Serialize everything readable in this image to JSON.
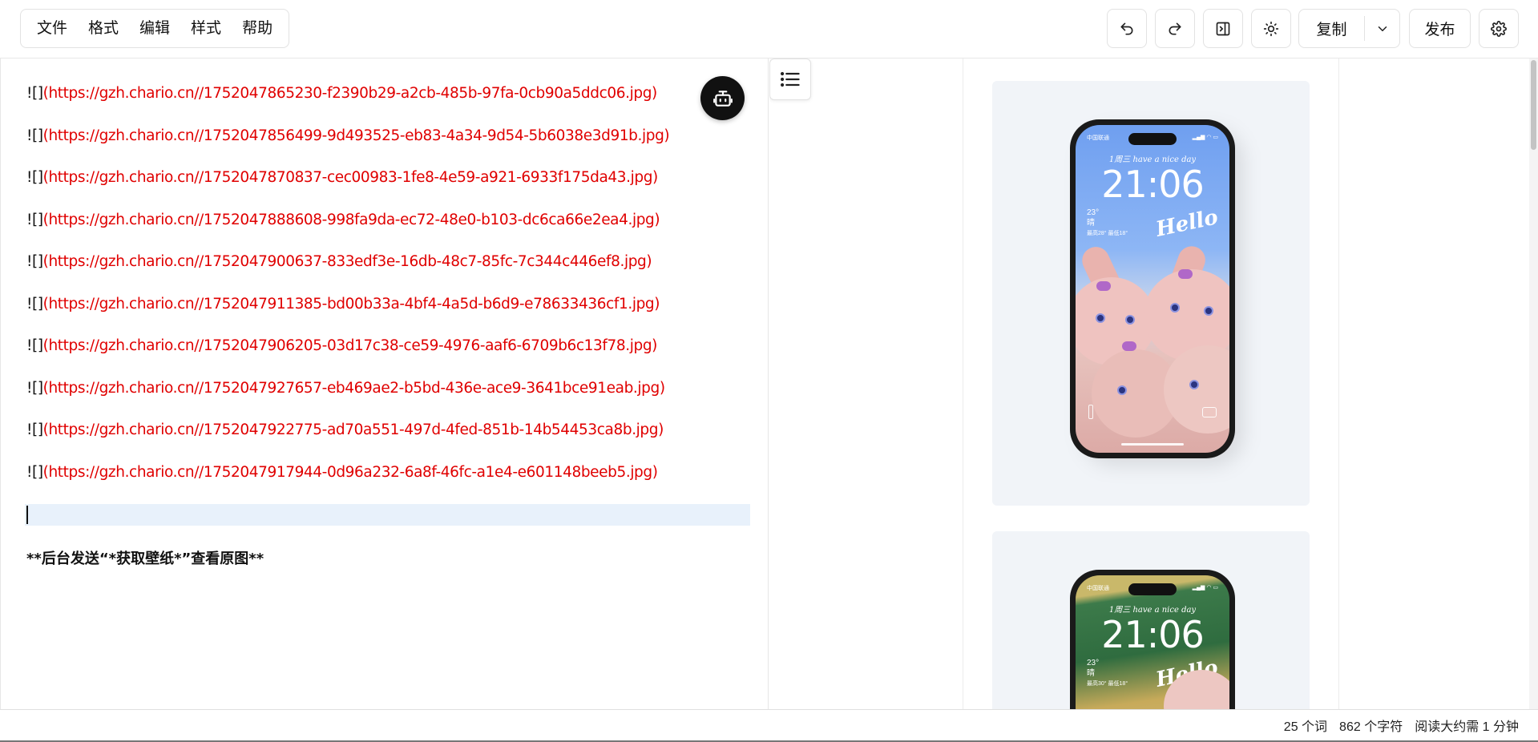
{
  "menu": {
    "items": [
      "文件",
      "格式",
      "编辑",
      "样式",
      "帮助"
    ]
  },
  "toolbar": {
    "undo_icon": "undo-icon",
    "redo_icon": "redo-icon",
    "toggle_preview_icon": "panel-toggle-icon",
    "theme_icon": "sun-icon",
    "copy_label": "复制",
    "copy_dropdown_icon": "chevron-down-icon",
    "publish_label": "发布",
    "settings_icon": "gear-icon"
  },
  "editor": {
    "lines": [
      {
        "prefix": "![]",
        "url": "(https://gzh.chario.cn//1752047865230-f2390b29-a2cb-485b-97fa-0cb90a5ddc06.jpg)"
      },
      {
        "prefix": "![]",
        "url": "(https://gzh.chario.cn//1752047856499-9d493525-eb83-4a34-9d54-5b6038e3d91b.jpg)"
      },
      {
        "prefix": "![]",
        "url": "(https://gzh.chario.cn//1752047870837-cec00983-1fe8-4e59-a921-6933f175da43.jpg)"
      },
      {
        "prefix": "![]",
        "url": "(https://gzh.chario.cn//1752047888608-998fa9da-ec72-48e0-b103-dc6ca66e2ea4.jpg)"
      },
      {
        "prefix": "![]",
        "url": "(https://gzh.chario.cn//1752047900637-833edf3e-16db-48c7-85fc-7c344c446ef8.jpg)"
      },
      {
        "prefix": "![]",
        "url": "(https://gzh.chario.cn//1752047911385-bd00b33a-4bf4-4a5d-b6d9-e78633436cf1.jpg)"
      },
      {
        "prefix": "![]",
        "url": "(https://gzh.chario.cn//1752047906205-03d17c38-ce59-4976-aaf6-6709b6c13f78.jpg)"
      },
      {
        "prefix": "![]",
        "url": "(https://gzh.chario.cn//1752047927657-eb469ae2-b5bd-436e-ace9-3641bce91eab.jpg)"
      },
      {
        "prefix": "![]",
        "url": "(https://gzh.chario.cn//1752047922775-ad70a551-497d-4fed-851b-14b54453ca8b.jpg)"
      },
      {
        "prefix": "![]",
        "url": "(https://gzh.chario.cn//1752047917944-0d96a232-6a8f-46fc-a1e4-e601148beeb5.jpg)"
      }
    ],
    "bold_line": "**后台发送“*获取壁纸*”查看原图**",
    "ai_icon": "robot-icon"
  },
  "preview": {
    "toc_icon": "list-icon",
    "phone1": {
      "status_left": "中国联通",
      "date": "1周三 have a nice day",
      "time": "21:06",
      "weather": "23°",
      "weather_desc": "晴",
      "weather_range": "最高28° 最低18°",
      "hello": "Hello"
    },
    "phone2": {
      "status_left": "中国联通",
      "date": "1周三 have a nice day",
      "time": "21:06",
      "weather": "23°",
      "weather_desc": "晴",
      "weather_range": "最高30° 最低18°",
      "hello": "Hello"
    }
  },
  "status": {
    "words": "25 个词",
    "chars": "862 个字符",
    "reading": "阅读大约需 1 分钟"
  },
  "colors": {
    "url_red": "#e00000",
    "active_line": "#e8f1fb",
    "phone1_sky": "#7aa8f0",
    "phone2_green": "#3c7a4a"
  }
}
